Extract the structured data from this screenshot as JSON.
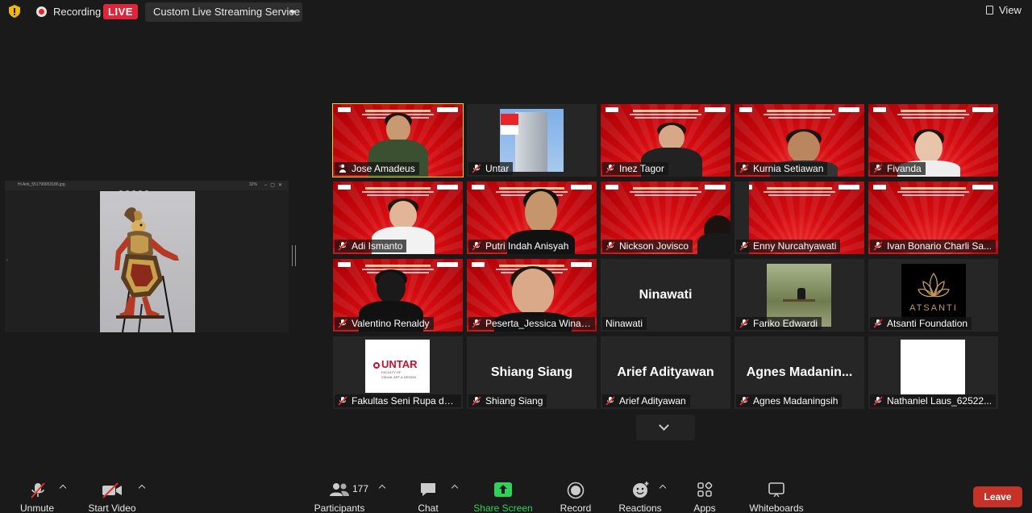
{
  "topbar": {
    "recording_label": "Recording",
    "live_label": "LIVE",
    "stream_service": "Custom Live Streaming Service",
    "view_label": "View"
  },
  "share": {
    "file_title": "Hi Anti_551799953186.jpg",
    "zoom": "32%"
  },
  "participants": [
    {
      "name": "Jose Amadeus",
      "type": "video",
      "active": true,
      "mic": "host"
    },
    {
      "name": "Untar",
      "type": "image",
      "mic": "muted"
    },
    {
      "name": "Inez Tagor",
      "type": "video",
      "mic": "muted"
    },
    {
      "name": "Kurnia Setiawan",
      "type": "video",
      "mic": "muted"
    },
    {
      "name": "Fivanda",
      "type": "video",
      "mic": "muted"
    },
    {
      "name": "Adi Ismanto",
      "type": "video",
      "mic": "muted"
    },
    {
      "name": "Putri Indah Anisyah",
      "type": "video",
      "mic": "muted"
    },
    {
      "name": "Nickson Jovisco",
      "type": "video",
      "mic": "muted"
    },
    {
      "name": "Enny Nurcahyawati",
      "type": "video",
      "mic": "muted"
    },
    {
      "name": "Ivan Bonario Charli Sa...",
      "type": "video",
      "mic": "muted"
    },
    {
      "name": "Valentino Renaldy",
      "type": "video",
      "mic": "muted"
    },
    {
      "name": "Peserta_Jessica Winar_...",
      "type": "video",
      "mic": "muted"
    },
    {
      "name": "Ninawati",
      "type": "text",
      "display": "Ninawati",
      "mic": "none"
    },
    {
      "name": "Fariko Edwardi",
      "type": "image",
      "mic": "muted"
    },
    {
      "name": "Atsanti Foundation",
      "type": "image",
      "mic": "muted"
    },
    {
      "name": "Fakultas Seni Rupa da...",
      "type": "image",
      "mic": "muted"
    },
    {
      "name": "Shiang Siang",
      "type": "text",
      "display": "Shiang Siang",
      "mic": "muted"
    },
    {
      "name": "Arief Adityawan",
      "type": "text",
      "display": "Arief Adityawan",
      "mic": "muted"
    },
    {
      "name": "Agnes Madaningsih",
      "type": "text",
      "display": "Agnes  Madanin...",
      "mic": "muted"
    },
    {
      "name": "Nathaniel Laus_62522...",
      "type": "image",
      "mic": "muted"
    }
  ],
  "tile_images": {
    "atsanti_text": "ATSANTI",
    "untar_logo_text": "UNTAR",
    "untar_sub1": "FACULTY OF",
    "untar_sub2": "VISUAL ART & DESIGN"
  },
  "toolbar": {
    "unmute": "Unmute",
    "start_video": "Start Video",
    "participants": "Participants",
    "participant_count": "177",
    "chat": "Chat",
    "share_screen": "Share Screen",
    "record": "Record",
    "reactions": "Reactions",
    "apps": "Apps",
    "whiteboards": "Whiteboards",
    "leave": "Leave"
  },
  "colors": {
    "live_red": "#e0243a",
    "share_green": "#2fd15a",
    "leave_red": "#c73228",
    "active_speaker": "#d6d646"
  }
}
